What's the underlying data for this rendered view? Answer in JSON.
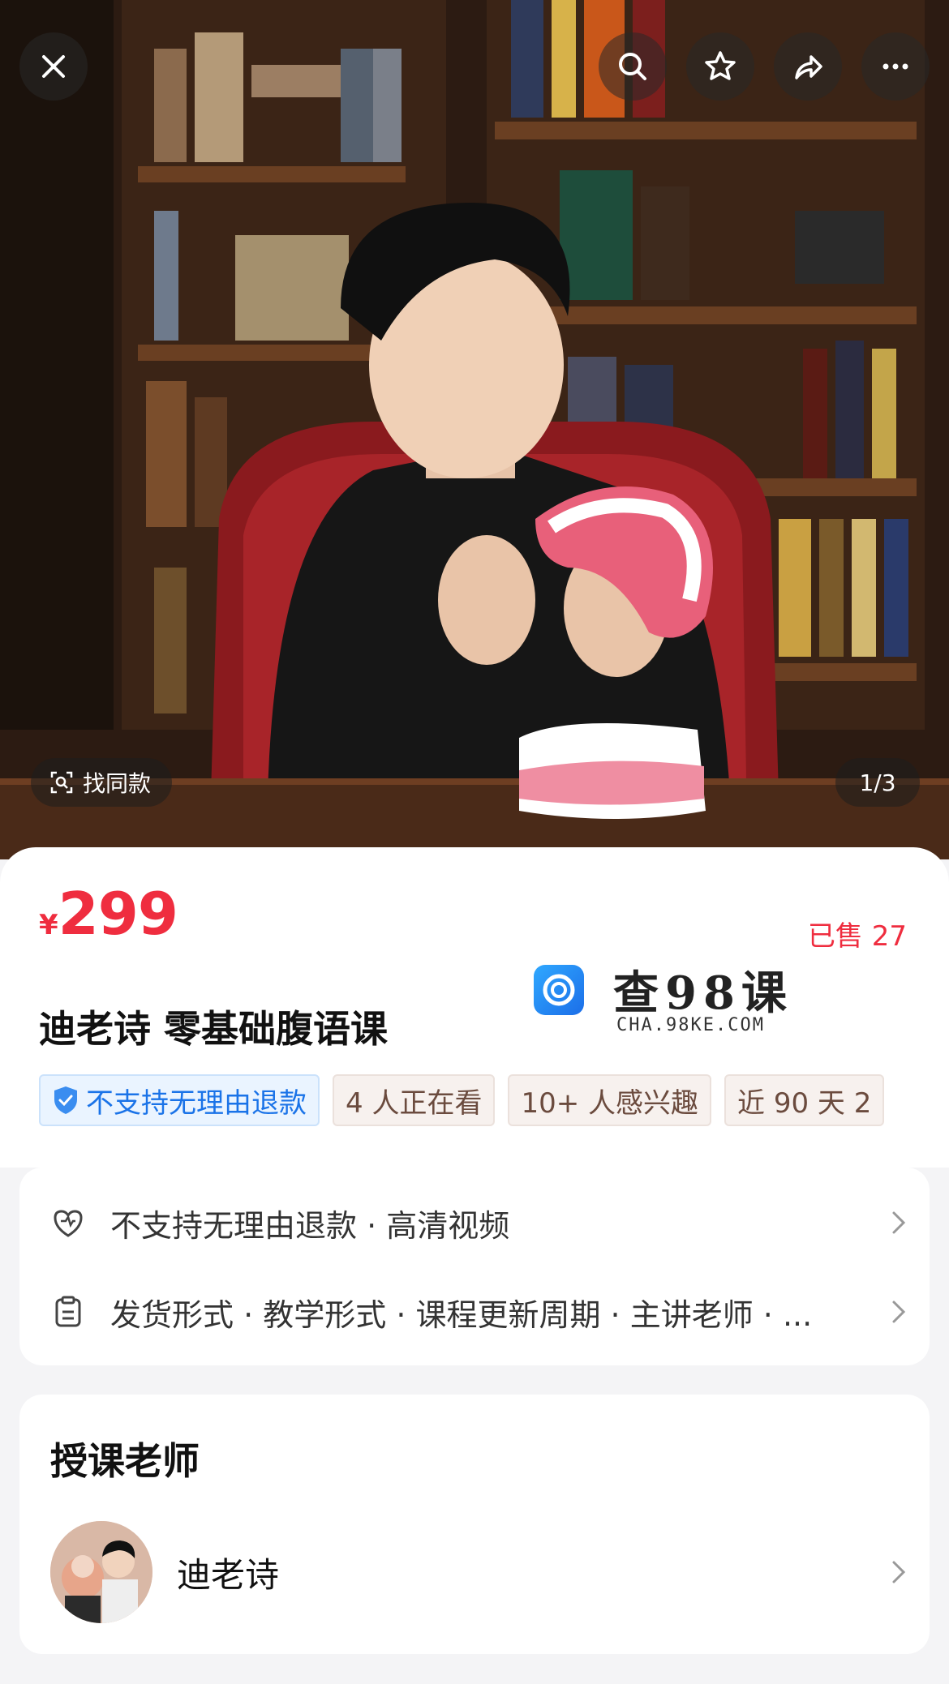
{
  "header": {
    "pager": "1/3",
    "find_same_label": "找同款"
  },
  "product": {
    "currency_symbol": "¥",
    "price": "299",
    "sold": "已售 27",
    "title": "迪老诗 零基础腹语课"
  },
  "watermark": {
    "title": "查98课",
    "subtitle": "CHA.98KE.COM"
  },
  "tags": [
    "不支持无理由退款",
    "4 人正在看",
    "10+ 人感兴趣",
    "近 90 天 2"
  ],
  "service": {
    "row1": "不支持无理由退款 · 高清视频",
    "row2": "发货形式 · 教学形式 · 课程更新周期 · 主讲老师 · ..."
  },
  "teacher": {
    "section_title": "授课老师",
    "name": "迪老诗"
  },
  "colors": {
    "price": "#ef2d3f",
    "tag_blue": "#1a73e8",
    "card_bg": "#ffffff",
    "page_bg": "#f4f4f6"
  },
  "icons": {
    "close": "close-icon",
    "search": "search-icon",
    "favorite": "star-icon",
    "share": "share-icon",
    "more": "more-icon",
    "refund": "heart-shield-icon",
    "details": "clipboard-icon",
    "chevron": "chevron-right-icon"
  }
}
